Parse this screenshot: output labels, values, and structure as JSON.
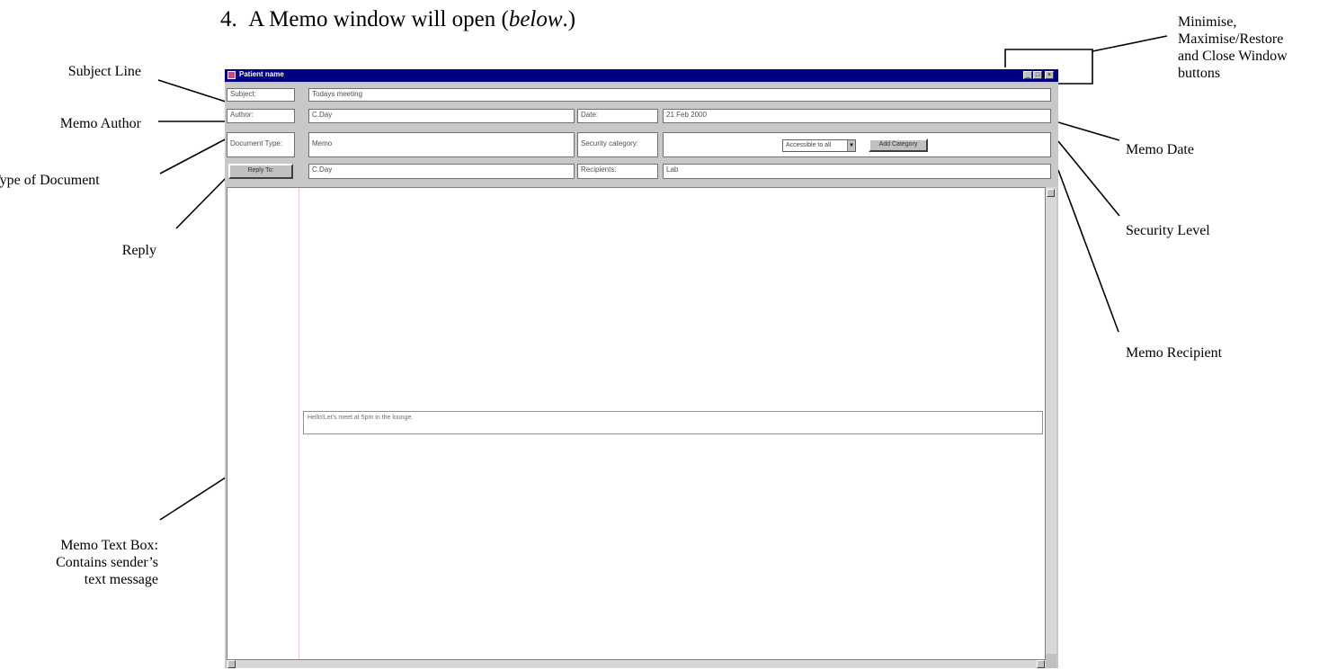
{
  "page": {
    "step_number": "4.",
    "step_text_before": "A Memo window will open (",
    "step_text_italic": "below",
    "step_text_after": ".)"
  },
  "callouts": {
    "subject_line": "Subject Line",
    "memo_author": "Memo Author",
    "type_of_document": "Type of Document",
    "reply": "Reply",
    "memo_text_box": [
      "Memo Text Box:",
      "Contains sender’s",
      "text message"
    ],
    "window_buttons": [
      "Minimise,",
      "Maximise/Restore",
      "and Close Window",
      "buttons"
    ],
    "memo_date": "Memo Date",
    "security_level": "Security Level",
    "memo_recipient": "Memo Recipient"
  },
  "window": {
    "title": "Patient name",
    "subject_label": "Subject:",
    "subject_value": "Todays meeting",
    "author_label": "Author:",
    "author_value": "C.Day",
    "date_label": "Date:",
    "date_value": "21 Feb 2000",
    "doc_type_label": "Document Type:",
    "doc_type_value": "Memo",
    "security_label": "Security category:",
    "security_selected": "Accessible to all",
    "add_category_button": "Add Category",
    "reply_button": "Reply To:",
    "reply_value": "C.Day",
    "recipients_label": "Recipients:",
    "recipients_value": "Lab",
    "memo_body": "Hello!Let's meet at 5pm in the lounge."
  }
}
